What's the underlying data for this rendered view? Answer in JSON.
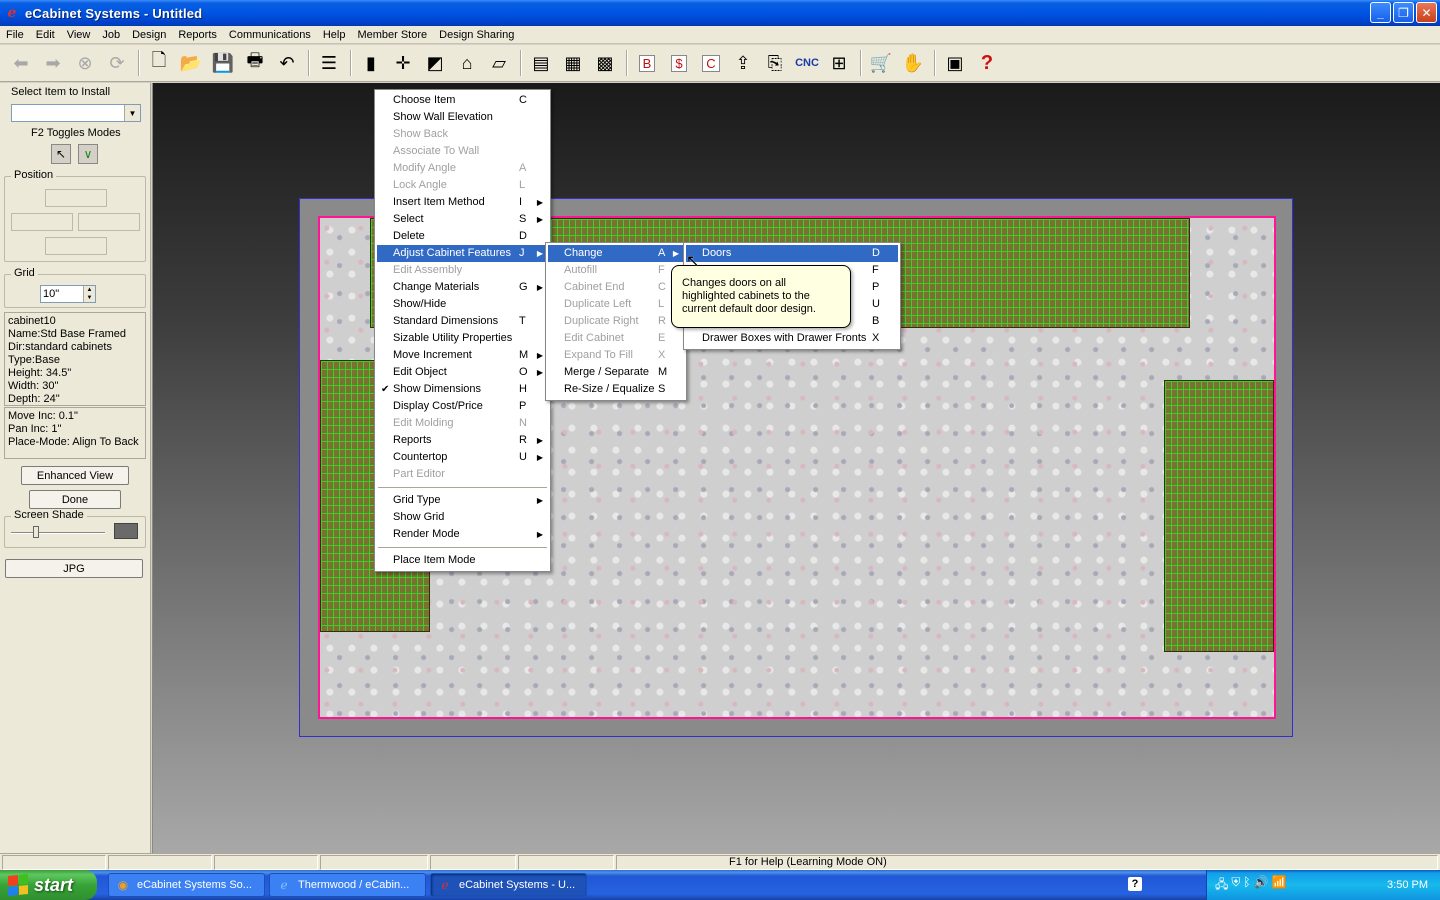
{
  "window": {
    "title": "eCabinet Systems - Untitled"
  },
  "menubar": [
    "File",
    "Edit",
    "View",
    "Job",
    "Design",
    "Reports",
    "Communications",
    "Help",
    "Member Store",
    "Design Sharing"
  ],
  "toolbar": {
    "icons": [
      {
        "name": "back-arrow-icon",
        "glyph": "⬅",
        "disabled": true
      },
      {
        "name": "forward-arrow-icon",
        "glyph": "➡",
        "disabled": true
      },
      {
        "name": "stop-icon",
        "glyph": "⊗",
        "disabled": true
      },
      {
        "name": "refresh-icon",
        "glyph": "⟳",
        "disabled": true
      },
      {
        "sep": true
      },
      {
        "name": "new-file-icon",
        "glyph": "🗋"
      },
      {
        "name": "open-folder-icon",
        "glyph": "📂"
      },
      {
        "name": "save-icon",
        "glyph": "💾"
      },
      {
        "name": "print-icon",
        "glyph": "🖶"
      },
      {
        "name": "undo-icon",
        "glyph": "↶"
      },
      {
        "sep": true
      },
      {
        "name": "settings-sliders-icon",
        "glyph": "☰"
      },
      {
        "sep": true
      },
      {
        "name": "materials-icon",
        "glyph": "▮"
      },
      {
        "name": "dimension-icon",
        "glyph": "✛"
      },
      {
        "name": "molding-icon",
        "glyph": "◩"
      },
      {
        "name": "arch-icon",
        "glyph": "⌂"
      },
      {
        "name": "countertop-icon",
        "glyph": "▱"
      },
      {
        "sep": true
      },
      {
        "name": "cabinet-icon",
        "glyph": "▤"
      },
      {
        "name": "cabinet-list-icon",
        "glyph": "▦"
      },
      {
        "name": "floor-plan-icon",
        "glyph": "▩"
      },
      {
        "sep": true
      },
      {
        "name": "bid-report-icon",
        "glyph": "B"
      },
      {
        "name": "price-report-icon",
        "glyph": "$"
      },
      {
        "name": "cutlist-report-icon",
        "glyph": "C"
      },
      {
        "name": "upload-icon",
        "glyph": "⇪"
      },
      {
        "name": "export-icon",
        "glyph": "⎘"
      },
      {
        "name": "cnc-icon",
        "glyph": "CNC"
      },
      {
        "name": "nesting-icon",
        "glyph": "⊞"
      },
      {
        "sep": true
      },
      {
        "name": "store-cart-icon",
        "glyph": "🛒"
      },
      {
        "name": "handshake-icon",
        "glyph": "✋"
      },
      {
        "sep": true
      },
      {
        "name": "render-view-icon",
        "glyph": "▣"
      },
      {
        "name": "help-question-icon",
        "glyph": "?"
      }
    ]
  },
  "left_panel": {
    "select_item_label": "Select Item to Install",
    "select_item_value": "",
    "f2_toggle_label": "F2 Toggles Modes",
    "position_label": "Position",
    "grid_label": "Grid",
    "grid_value": "10\"",
    "item_info": [
      "cabinet10",
      "Name:Std Base Framed",
      "Dir:standard cabinets",
      "Type:Base",
      "Height: 34.5\"",
      "Width: 30\"",
      "Depth: 24\""
    ],
    "increments": [
      "Move Inc: 0.1\"",
      "Pan Inc: 1\"",
      "Place-Mode: Align To Back"
    ],
    "enhanced_view_label": "Enhanced View",
    "done_label": "Done",
    "screen_shade_label": "Screen Shade",
    "jpg_label": "JPG",
    "colors": {
      "shade_swatch": "#6a6a6a"
    }
  },
  "context_menu": {
    "items": [
      {
        "label": "Choose Item",
        "key": "C"
      },
      {
        "label": "Show Wall Elevation",
        "key": ""
      },
      {
        "label": "Show Back",
        "key": "",
        "disabled": true
      },
      {
        "label": "Associate To Wall",
        "key": "",
        "disabled": true
      },
      {
        "label": "Modify Angle",
        "key": "A",
        "disabled": true
      },
      {
        "label": "Lock Angle",
        "key": "L",
        "disabled": true
      },
      {
        "label": "Insert Item Method",
        "key": "I",
        "submenu": true
      },
      {
        "label": "Select",
        "key": "S",
        "submenu": true
      },
      {
        "label": "Delete",
        "key": "D"
      },
      {
        "label": "Adjust Cabinet Features",
        "key": "J",
        "submenu": true,
        "highlighted": true
      },
      {
        "label": "Edit Assembly",
        "key": "",
        "disabled": true
      },
      {
        "label": "Change Materials",
        "key": "G",
        "submenu": true
      },
      {
        "label": "Show/Hide",
        "key": ""
      },
      {
        "label": "Standard Dimensions",
        "key": "T"
      },
      {
        "label": "Sizable Utility Properties",
        "key": ""
      },
      {
        "label": "Move Increment",
        "key": "M",
        "submenu": true
      },
      {
        "label": "Edit Object",
        "key": "O",
        "submenu": true
      },
      {
        "label": "Show Dimensions",
        "key": "H",
        "checked": true
      },
      {
        "label": "Display Cost/Price",
        "key": "P"
      },
      {
        "label": "Edit Molding",
        "key": "N",
        "disabled": true
      },
      {
        "label": "Reports",
        "key": "R",
        "submenu": true
      },
      {
        "label": "Countertop",
        "key": "U",
        "submenu": true
      },
      {
        "label": "Part Editor",
        "key": "",
        "disabled": true
      },
      {
        "sep": true
      },
      {
        "label": "Grid Type",
        "key": "",
        "submenu": true
      },
      {
        "label": "Show Grid",
        "key": ""
      },
      {
        "label": "Render Mode",
        "key": "",
        "submenu": true
      },
      {
        "sep": true
      },
      {
        "label": "Place Item Mode",
        "key": ""
      }
    ]
  },
  "submenu_adjust": {
    "items": [
      {
        "label": "Change",
        "key": "A",
        "submenu": true,
        "highlighted": true
      },
      {
        "label": "Autofill",
        "key": "F",
        "disabled": true
      },
      {
        "label": "Cabinet End",
        "key": "C",
        "disabled": true
      },
      {
        "label": "Duplicate Left",
        "key": "L",
        "disabled": true
      },
      {
        "label": "Duplicate Right",
        "key": "R",
        "disabled": true
      },
      {
        "label": "Edit Cabinet",
        "key": "E",
        "disabled": true
      },
      {
        "label": "Expand To Fill",
        "key": "X",
        "disabled": true
      },
      {
        "label": "Merge / Separate",
        "key": "M"
      },
      {
        "label": "Re-Size / Equalize",
        "key": "S"
      }
    ]
  },
  "submenu_change": {
    "items": [
      {
        "label": "Doors",
        "key": "D",
        "highlighted": true
      },
      {
        "label": "",
        "key": "F"
      },
      {
        "label": "",
        "key": "P"
      },
      {
        "label": "",
        "key": "U"
      },
      {
        "label": "",
        "key": "B"
      },
      {
        "label": "Drawer Boxes with Drawer Fronts",
        "key": "X"
      }
    ]
  },
  "tooltip": {
    "text": "Changes doors on all highlighted cabinets to the current default door design."
  },
  "statusbar": {
    "help_text": "F1 for Help (Learning Mode ON)"
  },
  "taskbar": {
    "start_label": "start",
    "tasks": [
      {
        "label": "eCabinet Systems So...",
        "icon": "browser-icon"
      },
      {
        "label": "Thermwood / eCabin...",
        "icon": "ie-icon"
      },
      {
        "label": "eCabinet Systems - U...",
        "icon": "ecabinet-icon",
        "active": true
      }
    ],
    "clock": "3:50 PM"
  }
}
